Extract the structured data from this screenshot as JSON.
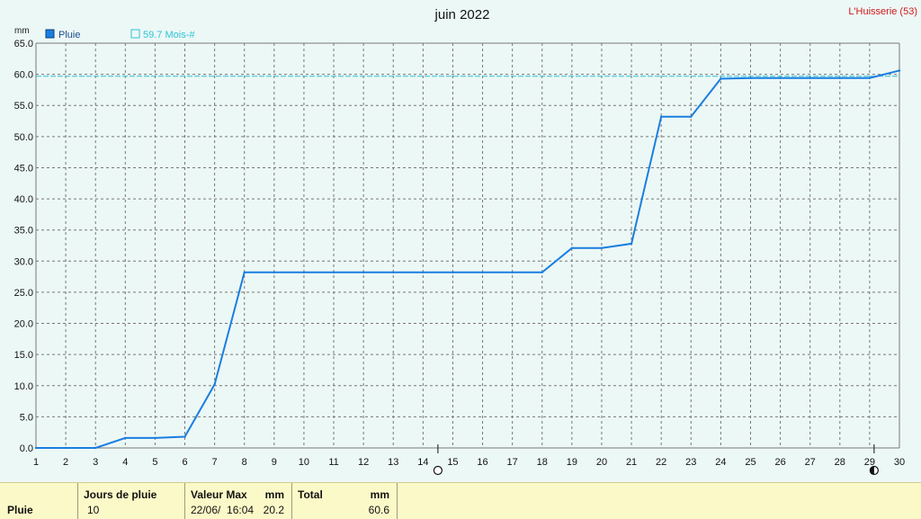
{
  "title": "juin 2022",
  "station": "L'Huisserie (53)",
  "colors": {
    "series": "#1a7ee0",
    "reference": "#2ec3d6",
    "grid": "#777777",
    "background": "#ecf8f6",
    "footer_bg": "#fcf9c8",
    "station_text": "#d01818"
  },
  "legend": {
    "series_label": "Pluie",
    "reference_label": "59.7 Mois-#"
  },
  "markers": {
    "new_moon_day_label": "15",
    "full_moon_day_label": "29"
  },
  "chart_data": {
    "type": "line",
    "title": "juin 2022",
    "ylabel": "mm",
    "xlabel": "",
    "ylim": [
      0,
      65
    ],
    "yticks": [
      "0.0",
      "5.0",
      "10.0",
      "15.0",
      "20.0",
      "25.0",
      "30.0",
      "35.0",
      "40.0",
      "45.0",
      "50.0",
      "55.0",
      "60.0",
      "65.0"
    ],
    "x": [
      1,
      2,
      3,
      4,
      5,
      6,
      7,
      8,
      9,
      10,
      11,
      12,
      13,
      14,
      15,
      16,
      17,
      18,
      19,
      20,
      21,
      22,
      23,
      24,
      25,
      26,
      27,
      28,
      29,
      30
    ],
    "series": [
      {
        "name": "Pluie",
        "values": [
          0,
          0,
          0,
          1.6,
          1.6,
          1.8,
          10.2,
          28.2,
          28.2,
          28.2,
          28.2,
          28.2,
          28.2,
          28.2,
          28.2,
          28.2,
          28.2,
          28.2,
          32.1,
          32.1,
          32.8,
          53.2,
          53.2,
          59.3,
          59.4,
          59.4,
          59.4,
          59.4,
          59.4,
          60.6
        ]
      }
    ],
    "reference_line": {
      "value": 59.7,
      "label": "59.7 Mois-#"
    },
    "grid": true,
    "legend_position": "top-left"
  },
  "footer": {
    "row_label": "Pluie",
    "jours_header": "Jours de pluie",
    "jours_value": "10",
    "valeur_max_header": "Valeur Max",
    "valeur_max_unit": "mm",
    "valeur_max_date": "22/06/  16:04",
    "valeur_max_value": "20.2",
    "total_header": "Total",
    "total_unit": "mm",
    "total_value": "60.6"
  }
}
